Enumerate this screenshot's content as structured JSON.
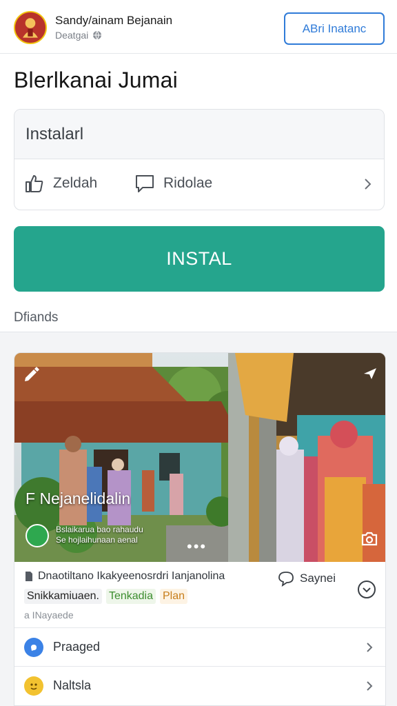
{
  "header": {
    "page_name": "Sandy/ainam Bejanain",
    "subtitle": "Deatgai",
    "action_button": "ABri Inatanc"
  },
  "title": "Blerlkanai Jumai",
  "options": {
    "heading": "Instalarl",
    "item1_label": "Zeldah",
    "item2_label": "Ridolae"
  },
  "install_button": "INSTAL",
  "friends_label": "Dfiands",
  "post": {
    "overlay_title": "F Nejanelidalin",
    "overlay_sub_line1": "Bslaikarua bao rahaudu",
    "overlay_sub_line2": "Se hojlaihunaan aenal",
    "overlay_dots": "•••",
    "meta_text": "Dnaotiltano Ikakyeenosrdri Ianjanolina",
    "reply_label": "Saynei",
    "tags": [
      "Snikkamiuaen.",
      "Tenkadia",
      "Plan"
    ],
    "date": "a INayaede",
    "rows": [
      {
        "label": "Praaged"
      },
      {
        "label": "Naltsla"
      }
    ]
  },
  "colors": {
    "accent_blue": "#2f7bd8",
    "install_green": "#25a58d",
    "tag_green": "#3c8d2f",
    "tag_orange": "#c77d1a"
  },
  "icons": [
    "globe-icon",
    "thumbs-up-icon",
    "comment-icon",
    "chevron-right-icon",
    "edit-icon",
    "share-icon",
    "camera-icon",
    "chevron-down-circle-icon",
    "document-icon",
    "info-icon",
    "emoji-icon"
  ]
}
